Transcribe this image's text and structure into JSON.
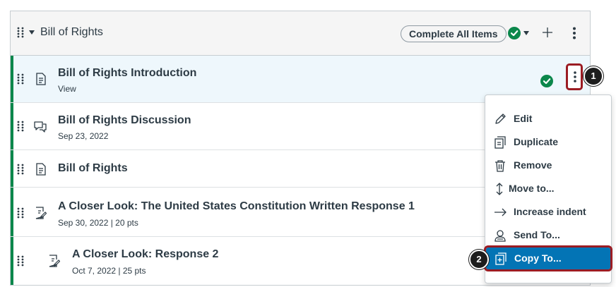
{
  "module": {
    "title": "Bill of Rights",
    "complete_all_label": "Complete All Items"
  },
  "items": [
    {
      "title": "Bill of Rights Introduction",
      "meta": "View",
      "type": "page"
    },
    {
      "title": "Bill of Rights Discussion",
      "meta": "Sep 23, 2022",
      "type": "discussion"
    },
    {
      "title": "Bill of Rights",
      "meta": "",
      "type": "page"
    },
    {
      "title": "A Closer Look: The United States Constitution Written Response 1",
      "meta": "Sep 30, 2022  |  20 pts",
      "type": "assignment"
    },
    {
      "title": "A Closer Look: Response 2",
      "meta": "Oct 7, 2022  |  25 pts",
      "type": "assignment"
    }
  ],
  "menu": {
    "items": [
      {
        "label": "Edit",
        "icon": "pencil-icon"
      },
      {
        "label": "Duplicate",
        "icon": "duplicate-icon"
      },
      {
        "label": "Remove",
        "icon": "trash-icon"
      },
      {
        "label": "Move to...",
        "icon": "move-icon"
      },
      {
        "label": "Increase indent",
        "icon": "arrow-right-icon"
      },
      {
        "label": "Send To...",
        "icon": "user-send-icon"
      },
      {
        "label": "Copy To...",
        "icon": "copy-icon"
      }
    ]
  },
  "callouts": [
    "1",
    "2"
  ],
  "colors": {
    "accent": "#0374b5",
    "success": "#0b874b",
    "callout_border": "#9b1c23",
    "text": "#2d3b45"
  }
}
